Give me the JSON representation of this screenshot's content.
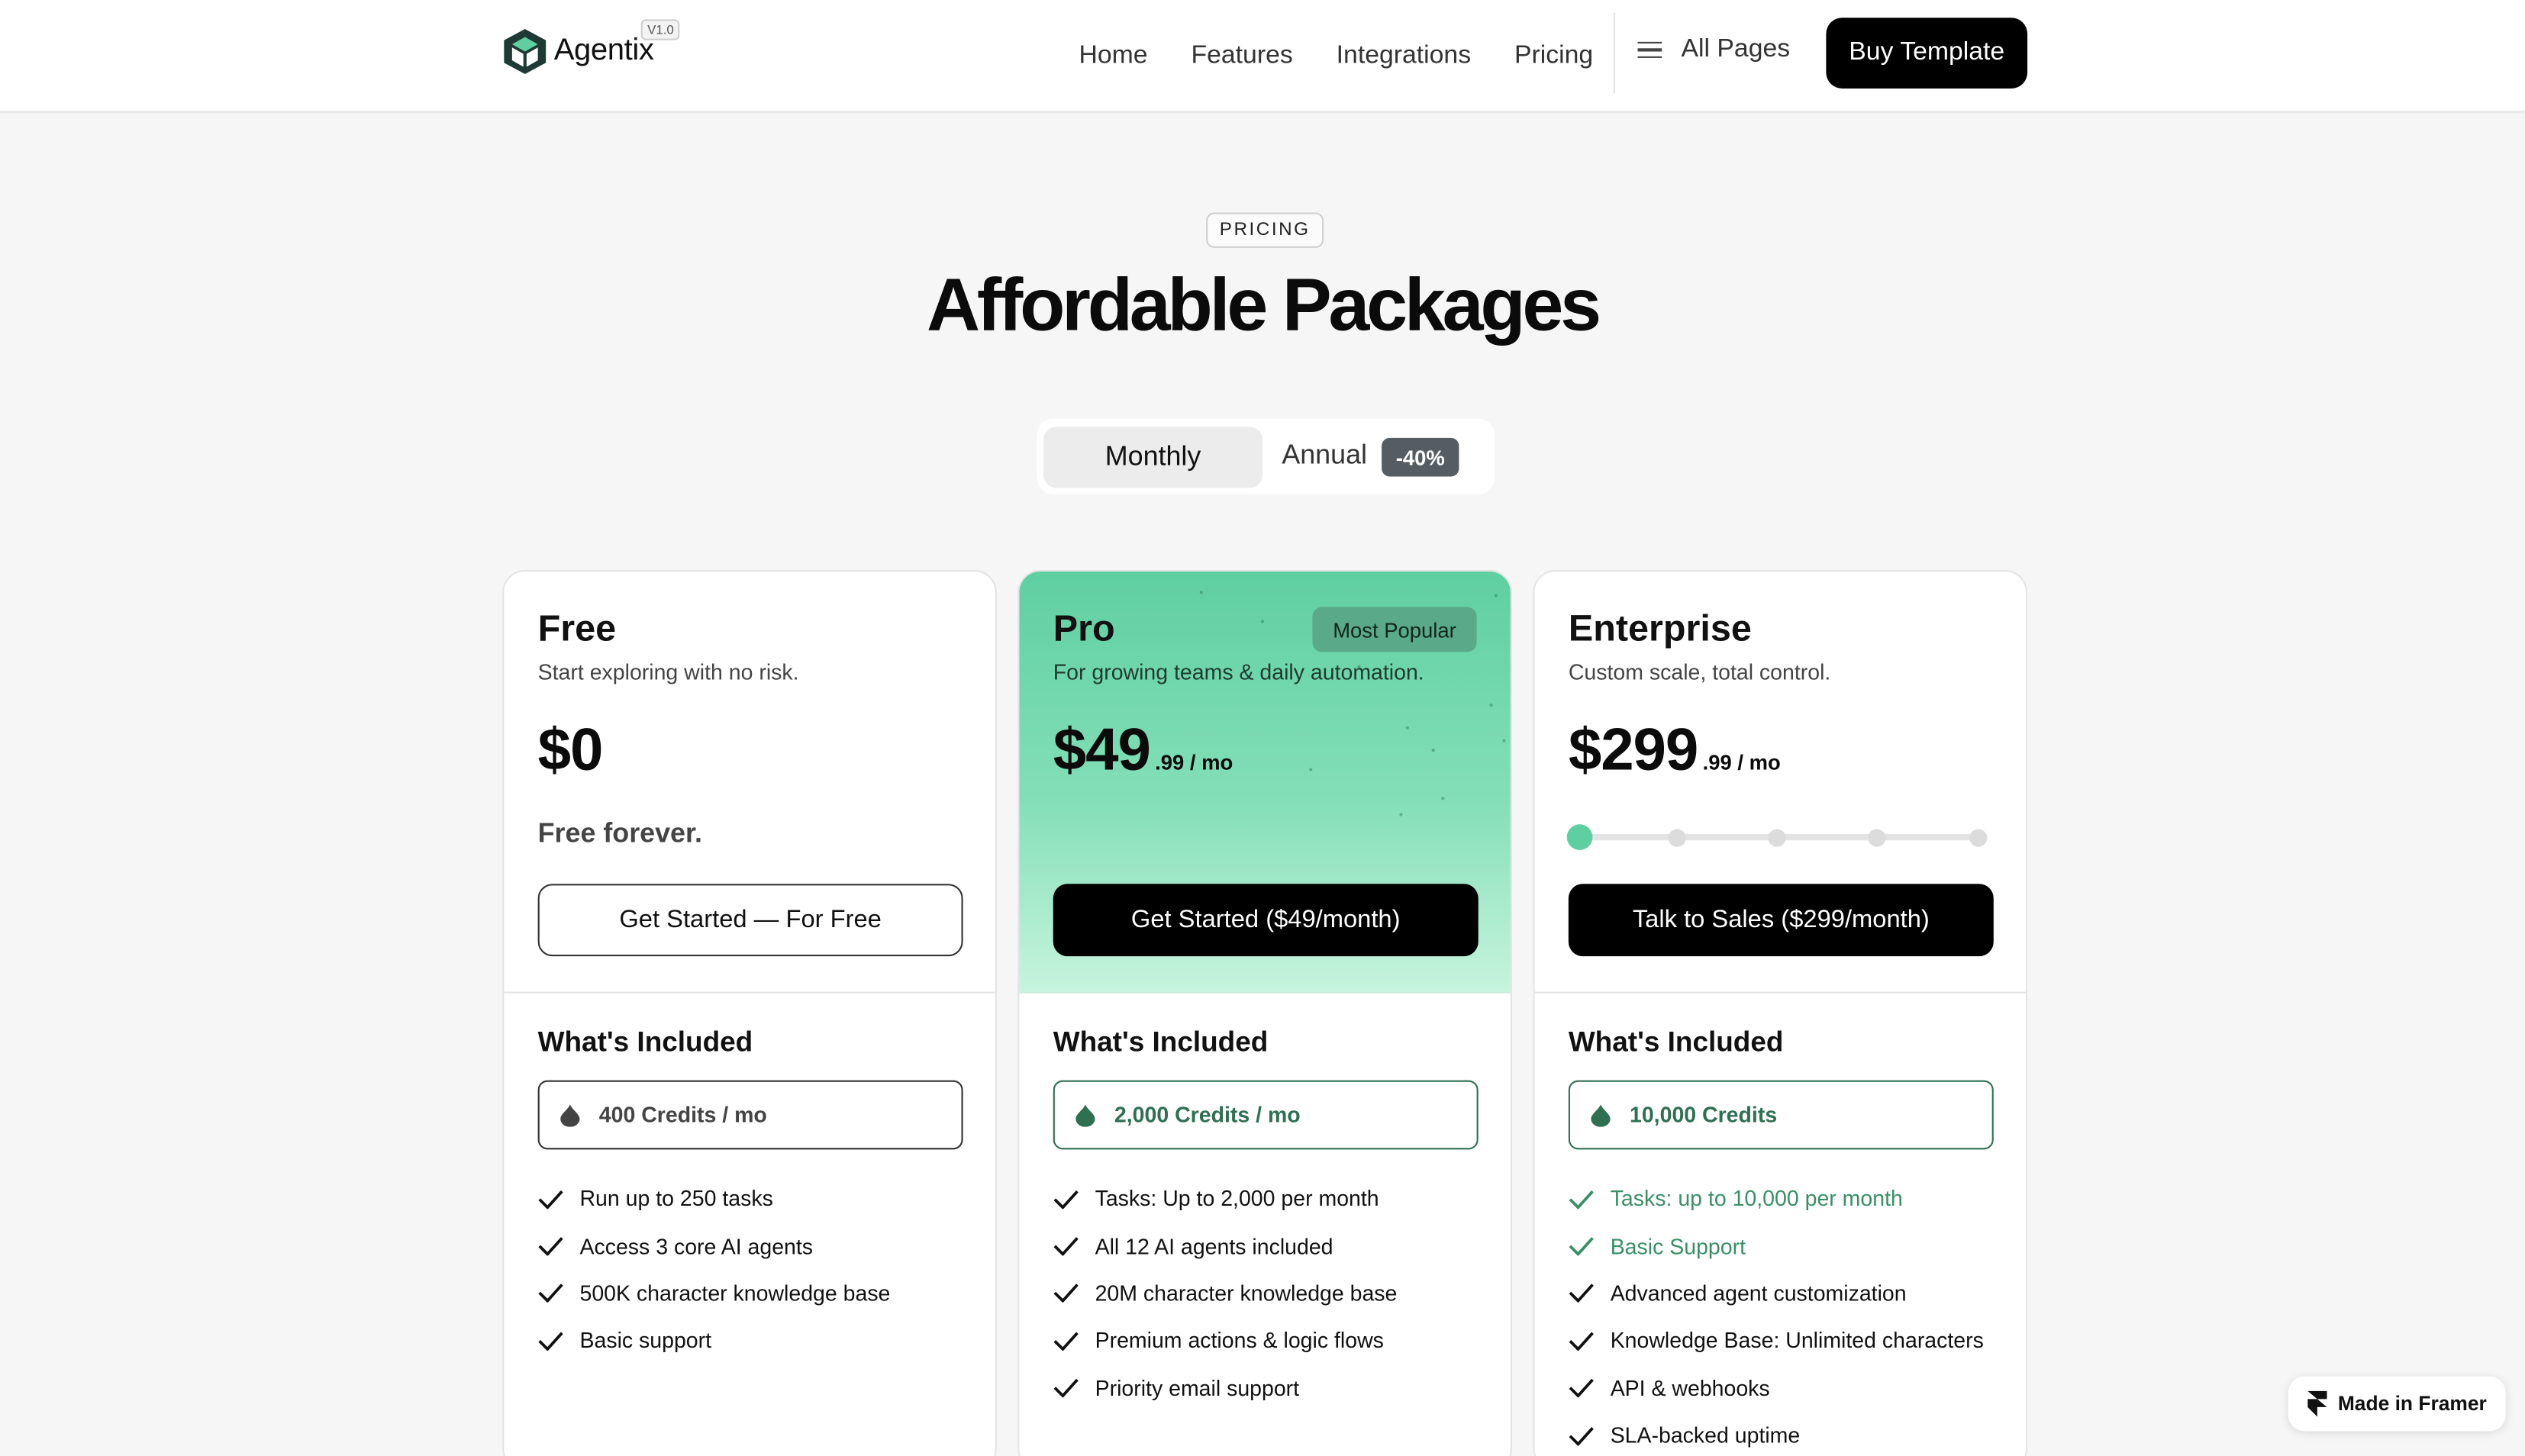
{
  "header": {
    "logo_text": "Agentix",
    "version": "V1.0",
    "nav": [
      "Home",
      "Features",
      "Integrations",
      "Pricing"
    ],
    "all_pages": "All Pages",
    "buy_button": "Buy Template"
  },
  "hero": {
    "tag": "PRICING",
    "title": "Affordable Packages"
  },
  "billing_toggle": {
    "monthly": "Monthly",
    "annual": "Annual",
    "discount": "-40%",
    "selected": "Monthly"
  },
  "plans": [
    {
      "name": "Free",
      "subtitle": "Start exploring with no risk.",
      "price": "$0",
      "note": "Free forever.",
      "cta": "Get Started — For Free",
      "included_title": "What's Included",
      "credits": "400 Credits / mo",
      "features": [
        "Run up to 250 tasks",
        "Access 3 core AI agents",
        "500K character knowledge base",
        "Basic support"
      ]
    },
    {
      "name": "Pro",
      "badge": "Most Popular",
      "subtitle": "For growing teams & daily automation.",
      "price": "$49",
      "price_suffix": ".99 / mo",
      "cta": "Get Started ($49/month)",
      "included_title": "What's Included",
      "credits": "2,000 Credits / mo",
      "features": [
        "Tasks: Up to 2,000 per month",
        "All 12 AI agents included",
        "20M character knowledge base",
        "Premium actions & logic flows",
        "Priority email support"
      ]
    },
    {
      "name": "Enterprise",
      "subtitle": "Custom scale, total control.",
      "price": "$299",
      "price_suffix": ".99 / mo",
      "tier_slider_steps": 5,
      "tier_slider_selected": 1,
      "cta": "Talk to Sales ($299/month)",
      "included_title": "What's Included",
      "credits": "10,000 Credits",
      "features": [
        "Tasks: up to 10,000 per month",
        "Basic Support",
        "Advanced agent customization",
        "Knowledge Base: Unlimited characters",
        "API & webhooks",
        "SLA-backed uptime"
      ],
      "highlighted_features": 2
    }
  ],
  "framer_badge": "Made in Framer",
  "colors": {
    "accent_green": "#5fcfa1",
    "credit_green": "#2f6f52",
    "button_black": "#000000",
    "badge_gray": "#555d63"
  }
}
